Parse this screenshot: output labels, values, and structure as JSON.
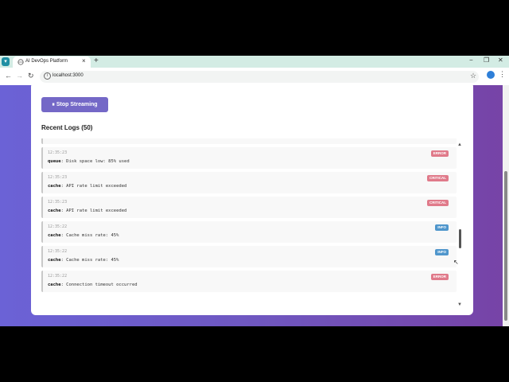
{
  "browser": {
    "tab_title": "AI DevOps Platform",
    "url": "localhost:3000",
    "new_tab": "+",
    "tab_close": "×",
    "minimize": "−",
    "maximize": "❐",
    "close": "✕",
    "back": "←",
    "forward": "→",
    "reload": "↻",
    "bookmark": "☆",
    "menu": "⋮",
    "dropdown": "▾"
  },
  "page": {
    "stop_button": "⏸ Stop Streaming",
    "logs_heading": "Recent Logs (50)"
  },
  "logs": [
    {
      "time": "",
      "source": "queue",
      "message": ": Disk space low: 85% used",
      "level": "",
      "level_color": "#e07a8a"
    },
    {
      "time": "12:35:23",
      "source": "queue",
      "message": ": Disk space low: 85% used",
      "level": "ERROR",
      "level_color": "#e07a8a"
    },
    {
      "time": "12:35:23",
      "source": "cache",
      "message": ": API rate limit exceeded",
      "level": "CRITICAL",
      "level_color": "#e07a8a"
    },
    {
      "time": "12:35:23",
      "source": "cache",
      "message": ": API rate limit exceeded",
      "level": "CRITICAL",
      "level_color": "#e07a8a"
    },
    {
      "time": "12:35:22",
      "source": "cache",
      "message": ": Cache miss rate: 45%",
      "level": "INFO",
      "level_color": "#4f96cc"
    },
    {
      "time": "12:35:22",
      "source": "cache",
      "message": ": Cache miss rate: 45%",
      "level": "INFO",
      "level_color": "#4f96cc"
    },
    {
      "time": "12:35:22",
      "source": "cache",
      "message": ": Connection timeout occurred",
      "level": "ERROR",
      "level_color": "#e07a8a"
    }
  ],
  "colors": {
    "accent": "#7468c7",
    "gradient_start": "#6b62d6",
    "gradient_end": "#7743a6"
  }
}
